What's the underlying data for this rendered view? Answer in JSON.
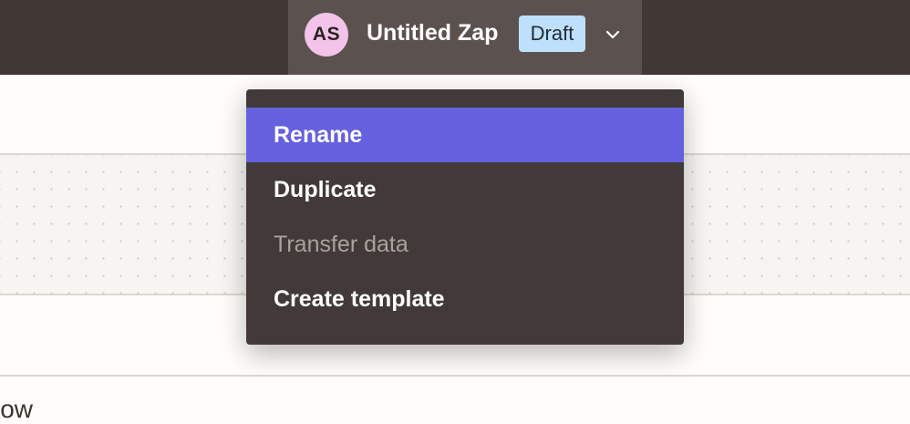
{
  "header": {
    "avatar_initials": "AS",
    "zap_name": "Untitled Zap",
    "status_badge": "Draft",
    "chevron_icon": "chevron-down-icon"
  },
  "menu": {
    "items": [
      {
        "label": "Rename",
        "state": "highlighted"
      },
      {
        "label": "Duplicate",
        "state": "enabled"
      },
      {
        "label": "Transfer data",
        "state": "disabled"
      },
      {
        "label": "Create template",
        "state": "enabled"
      }
    ]
  },
  "background": {
    "partial_text": "low"
  },
  "colors": {
    "topbar": "#413735",
    "title_button": "#5b524f",
    "avatar": "#f3c3ea",
    "badge": "#bfe0fb",
    "menu_bg": "#413a38",
    "menu_highlight": "#6560dd"
  }
}
